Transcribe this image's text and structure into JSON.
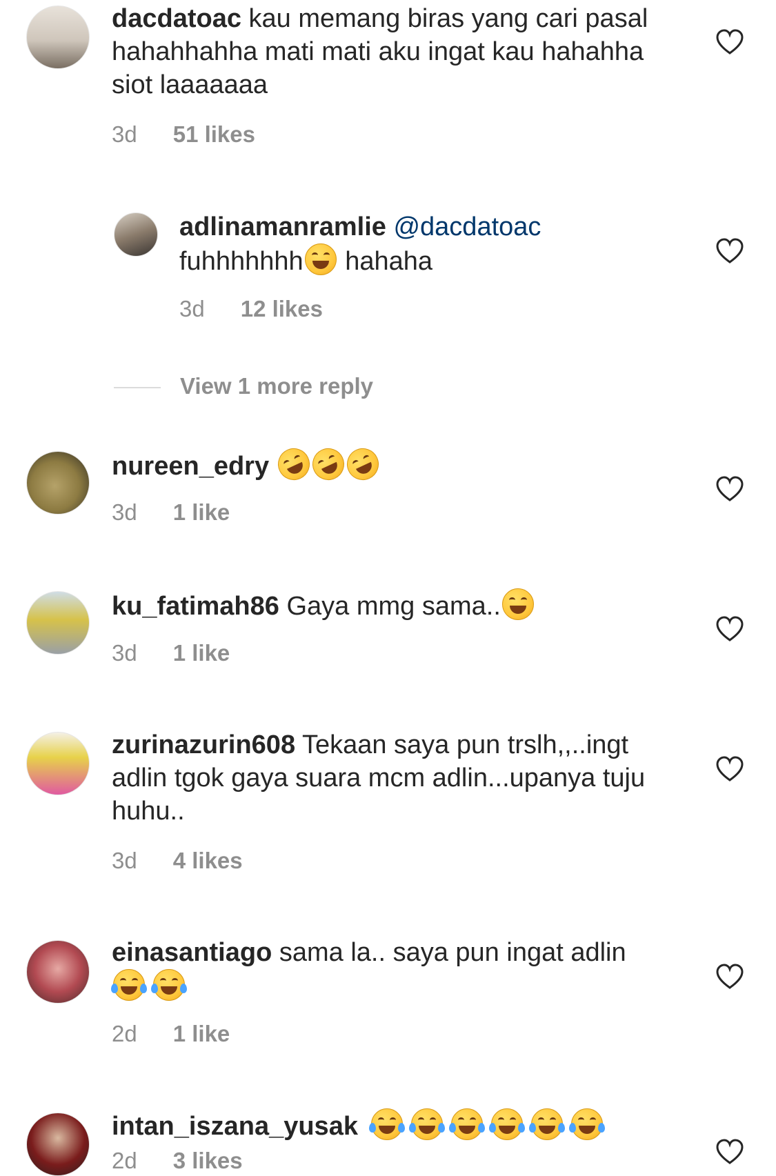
{
  "comments": [
    {
      "username": "dacdatoac",
      "text": "kau memang biras yang cari pasal hahahhahha mati mati aku ingat kau hahahha siot laaaaaaa",
      "time": "3d",
      "likes": "51 likes"
    },
    {
      "username": "adlinamanramlie",
      "mention": "@dacdatoac",
      "text_before": "fuhhhhhhh",
      "text_after": " hahaha",
      "time": "3d",
      "likes": "12 likes"
    },
    {
      "username": "nureen_edry",
      "time": "3d",
      "likes": "1 like"
    },
    {
      "username": "ku_fatimah86",
      "text": "Gaya mmg sama..",
      "time": "3d",
      "likes": "1 like"
    },
    {
      "username": "zurinazurin608",
      "text": "Tekaan saya pun trslh,,..ingt adlin tgok gaya suara mcm adlin...upanya tuju huhu..",
      "time": "3d",
      "likes": "4 likes"
    },
    {
      "username": "einasantiago",
      "text": "sama la.. saya pun ingat adlin",
      "time": "2d",
      "likes": "1 like"
    },
    {
      "username": "intan_iszana_yusak",
      "time": "2d",
      "likes": "3 likes"
    }
  ],
  "view_more": "View 1 more reply",
  "icons": {
    "like": "heart-outline-icon",
    "emoji_rofl": "rolling-on-floor-laughing-emoji",
    "emoji_grin_sweat": "grinning-sweat-emoji",
    "emoji_squint": "grinning-squinting-emoji",
    "emoji_tears": "tears-of-joy-emoji"
  },
  "colors": {
    "text": "#262626",
    "meta": "#8e8e8e",
    "mention": "#00376b",
    "background": "#ffffff"
  }
}
